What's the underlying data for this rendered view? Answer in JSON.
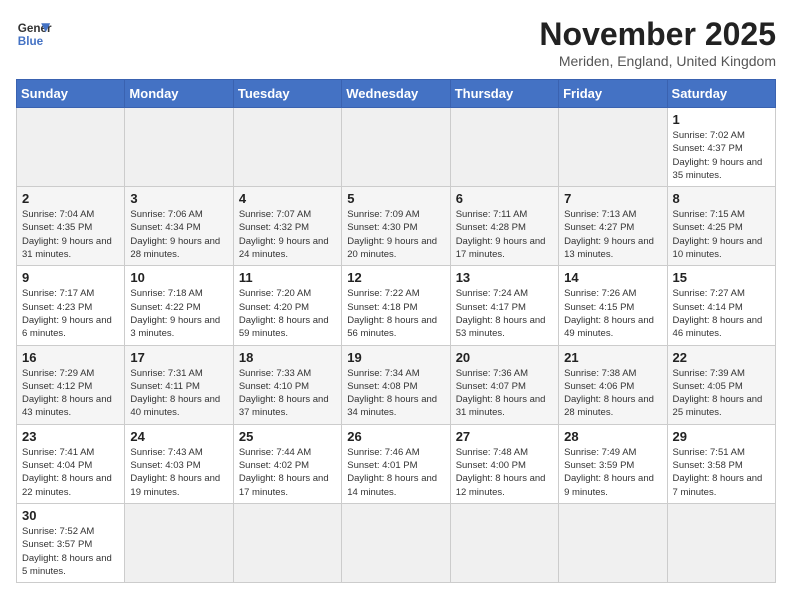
{
  "logo": {
    "line1": "General",
    "line2": "Blue"
  },
  "title": "November 2025",
  "subtitle": "Meriden, England, United Kingdom",
  "weekdays": [
    "Sunday",
    "Monday",
    "Tuesday",
    "Wednesday",
    "Thursday",
    "Friday",
    "Saturday"
  ],
  "weeks": [
    [
      {
        "day": "",
        "info": ""
      },
      {
        "day": "",
        "info": ""
      },
      {
        "day": "",
        "info": ""
      },
      {
        "day": "",
        "info": ""
      },
      {
        "day": "",
        "info": ""
      },
      {
        "day": "",
        "info": ""
      },
      {
        "day": "1",
        "info": "Sunrise: 7:02 AM\nSunset: 4:37 PM\nDaylight: 9 hours and 35 minutes."
      }
    ],
    [
      {
        "day": "2",
        "info": "Sunrise: 7:04 AM\nSunset: 4:35 PM\nDaylight: 9 hours and 31 minutes."
      },
      {
        "day": "3",
        "info": "Sunrise: 7:06 AM\nSunset: 4:34 PM\nDaylight: 9 hours and 28 minutes."
      },
      {
        "day": "4",
        "info": "Sunrise: 7:07 AM\nSunset: 4:32 PM\nDaylight: 9 hours and 24 minutes."
      },
      {
        "day": "5",
        "info": "Sunrise: 7:09 AM\nSunset: 4:30 PM\nDaylight: 9 hours and 20 minutes."
      },
      {
        "day": "6",
        "info": "Sunrise: 7:11 AM\nSunset: 4:28 PM\nDaylight: 9 hours and 17 minutes."
      },
      {
        "day": "7",
        "info": "Sunrise: 7:13 AM\nSunset: 4:27 PM\nDaylight: 9 hours and 13 minutes."
      },
      {
        "day": "8",
        "info": "Sunrise: 7:15 AM\nSunset: 4:25 PM\nDaylight: 9 hours and 10 minutes."
      }
    ],
    [
      {
        "day": "9",
        "info": "Sunrise: 7:17 AM\nSunset: 4:23 PM\nDaylight: 9 hours and 6 minutes."
      },
      {
        "day": "10",
        "info": "Sunrise: 7:18 AM\nSunset: 4:22 PM\nDaylight: 9 hours and 3 minutes."
      },
      {
        "day": "11",
        "info": "Sunrise: 7:20 AM\nSunset: 4:20 PM\nDaylight: 8 hours and 59 minutes."
      },
      {
        "day": "12",
        "info": "Sunrise: 7:22 AM\nSunset: 4:18 PM\nDaylight: 8 hours and 56 minutes."
      },
      {
        "day": "13",
        "info": "Sunrise: 7:24 AM\nSunset: 4:17 PM\nDaylight: 8 hours and 53 minutes."
      },
      {
        "day": "14",
        "info": "Sunrise: 7:26 AM\nSunset: 4:15 PM\nDaylight: 8 hours and 49 minutes."
      },
      {
        "day": "15",
        "info": "Sunrise: 7:27 AM\nSunset: 4:14 PM\nDaylight: 8 hours and 46 minutes."
      }
    ],
    [
      {
        "day": "16",
        "info": "Sunrise: 7:29 AM\nSunset: 4:12 PM\nDaylight: 8 hours and 43 minutes."
      },
      {
        "day": "17",
        "info": "Sunrise: 7:31 AM\nSunset: 4:11 PM\nDaylight: 8 hours and 40 minutes."
      },
      {
        "day": "18",
        "info": "Sunrise: 7:33 AM\nSunset: 4:10 PM\nDaylight: 8 hours and 37 minutes."
      },
      {
        "day": "19",
        "info": "Sunrise: 7:34 AM\nSunset: 4:08 PM\nDaylight: 8 hours and 34 minutes."
      },
      {
        "day": "20",
        "info": "Sunrise: 7:36 AM\nSunset: 4:07 PM\nDaylight: 8 hours and 31 minutes."
      },
      {
        "day": "21",
        "info": "Sunrise: 7:38 AM\nSunset: 4:06 PM\nDaylight: 8 hours and 28 minutes."
      },
      {
        "day": "22",
        "info": "Sunrise: 7:39 AM\nSunset: 4:05 PM\nDaylight: 8 hours and 25 minutes."
      }
    ],
    [
      {
        "day": "23",
        "info": "Sunrise: 7:41 AM\nSunset: 4:04 PM\nDaylight: 8 hours and 22 minutes."
      },
      {
        "day": "24",
        "info": "Sunrise: 7:43 AM\nSunset: 4:03 PM\nDaylight: 8 hours and 19 minutes."
      },
      {
        "day": "25",
        "info": "Sunrise: 7:44 AM\nSunset: 4:02 PM\nDaylight: 8 hours and 17 minutes."
      },
      {
        "day": "26",
        "info": "Sunrise: 7:46 AM\nSunset: 4:01 PM\nDaylight: 8 hours and 14 minutes."
      },
      {
        "day": "27",
        "info": "Sunrise: 7:48 AM\nSunset: 4:00 PM\nDaylight: 8 hours and 12 minutes."
      },
      {
        "day": "28",
        "info": "Sunrise: 7:49 AM\nSunset: 3:59 PM\nDaylight: 8 hours and 9 minutes."
      },
      {
        "day": "29",
        "info": "Sunrise: 7:51 AM\nSunset: 3:58 PM\nDaylight: 8 hours and 7 minutes."
      }
    ],
    [
      {
        "day": "30",
        "info": "Sunrise: 7:52 AM\nSunset: 3:57 PM\nDaylight: 8 hours and 5 minutes."
      },
      {
        "day": "",
        "info": ""
      },
      {
        "day": "",
        "info": ""
      },
      {
        "day": "",
        "info": ""
      },
      {
        "day": "",
        "info": ""
      },
      {
        "day": "",
        "info": ""
      },
      {
        "day": "",
        "info": ""
      }
    ]
  ]
}
